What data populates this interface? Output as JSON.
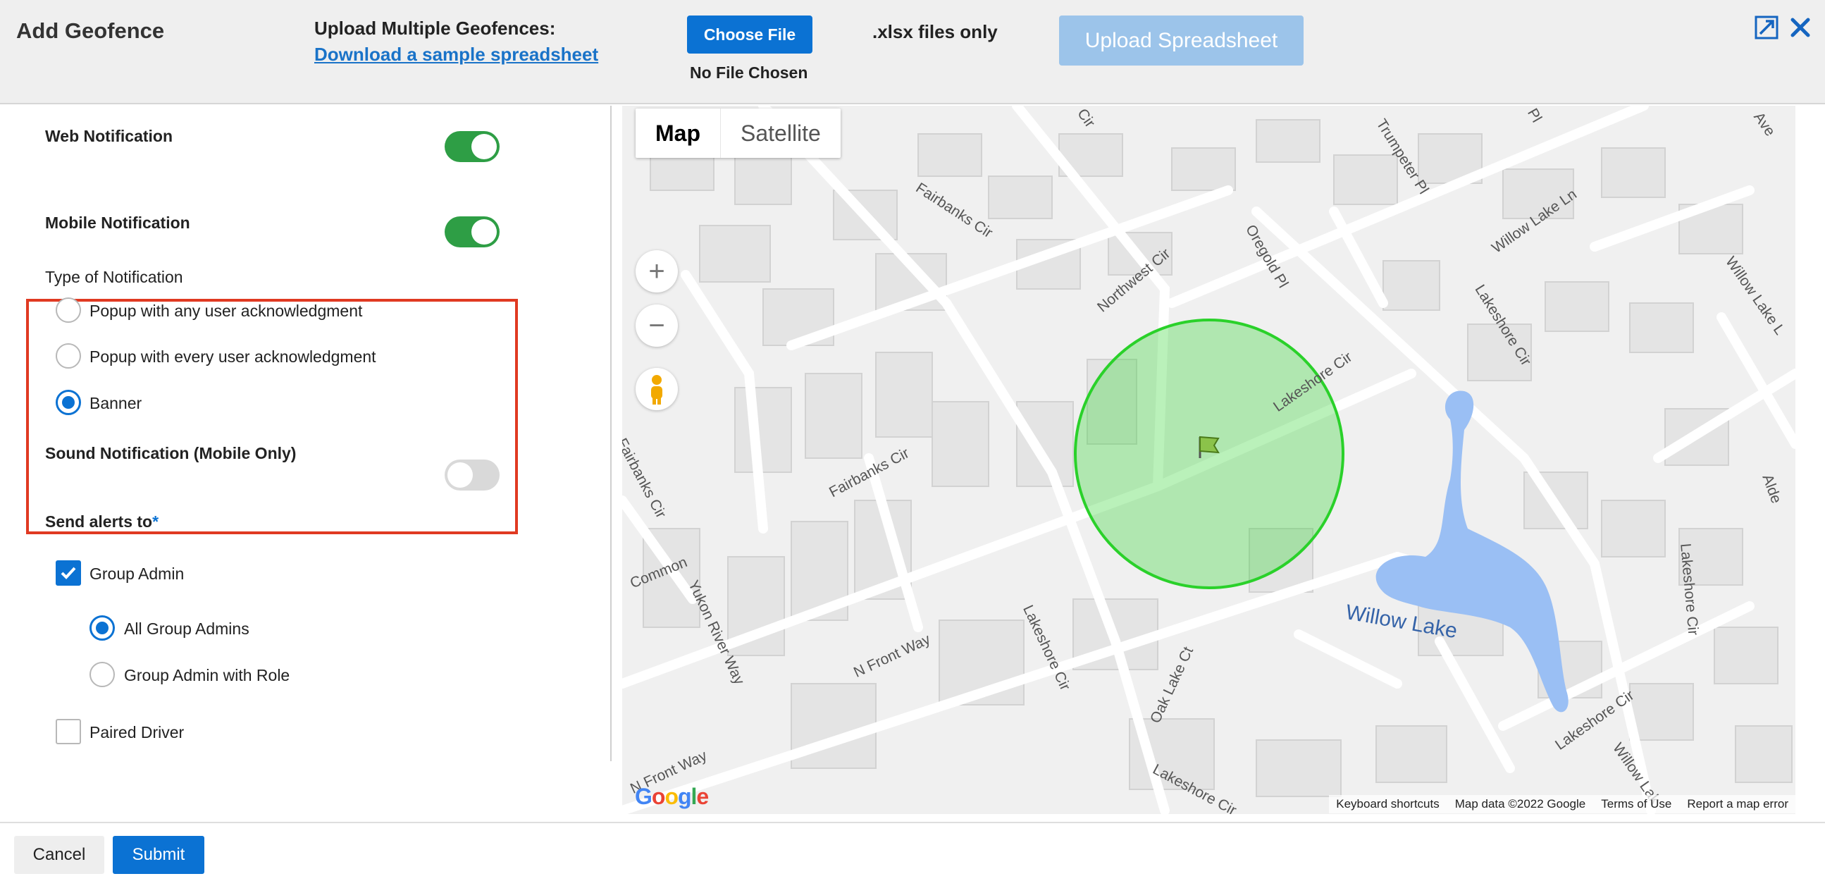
{
  "header": {
    "title": "Add Geofence",
    "upload_label": "Upload Multiple Geofences:",
    "sample_link": "Download a sample spreadsheet",
    "choose_file": "Choose File",
    "no_file": "No File Chosen",
    "xlsx_only": ".xlsx files only",
    "upload_button": "Upload Spreadsheet",
    "icons": [
      "expand-icon",
      "close-icon"
    ]
  },
  "form": {
    "web_notification": {
      "label": "Web Notification",
      "enabled": true
    },
    "mobile_notification": {
      "label": "Mobile Notification",
      "enabled": true
    },
    "type_label": "Type of Notification",
    "types": [
      {
        "label": "Popup with any user acknowledgment",
        "selected": false
      },
      {
        "label": "Popup with every user acknowledgment",
        "selected": false
      },
      {
        "label": "Banner",
        "selected": true
      }
    ],
    "sound_notification": {
      "label": "Sound Notification (Mobile Only)",
      "enabled": false
    },
    "send_alerts_label": "Send alerts to",
    "required_mark": "*",
    "group_admin": {
      "label": "Group Admin",
      "checked": true
    },
    "group_admin_options": [
      {
        "label": "All Group Admins",
        "selected": true
      },
      {
        "label": "Group Admin with Role",
        "selected": false
      }
    ],
    "paired_driver": {
      "label": "Paired Driver",
      "checked": false
    }
  },
  "map": {
    "map_tab": "Map",
    "satellite_tab": "Satellite",
    "zoom_in": "+",
    "zoom_out": "−",
    "google": "Google",
    "attribution": {
      "shortcuts": "Keyboard shortcuts",
      "data": "Map data ©2022 Google",
      "terms": "Terms of Use",
      "report": "Report a map error"
    },
    "labels": {
      "fairbanks_cir_1": "Fairbanks Cir",
      "fairbanks_cir_2": "Fairbanks Cir",
      "fairbanks_cir_3": "Fairbanks Cir",
      "northwest_cir": "Northwest Cir",
      "oregold_pl": "Oregold Pl",
      "trumpeter_pl": "Trumpeter Pl",
      "willow_lake_ln": "Willow Lake Ln",
      "willow_lake_l": "Willow Lake L",
      "lakeshore_cir_1": "Lakeshore Cir",
      "lakeshore_cir_2": "Lakeshore Cir",
      "lakeshore_cir_3": "Lakeshore Cir",
      "lakeshore_cir_4": "Lakeshore Cir",
      "lakeshore_cir_5": "Lakeshore Cir",
      "lakeshore_cir_6": "Lakeshore Cir",
      "yukon_river_way": "Yukon River Way",
      "n_front_way_1": "N Front Way",
      "n_front_way_2": "N Front Way",
      "oak_lake_ct": "Oak Lake Ct",
      "common": "Common",
      "willow_lake": "Willow Lake",
      "willow_lak": "Willow Lak",
      "alde": "Alde",
      "ave": "Ave",
      "cir": "Cir",
      "pl": "Pl"
    },
    "geofence_color": "#39d839"
  },
  "footer": {
    "cancel": "Cancel",
    "submit": "Submit"
  },
  "colors": {
    "primary": "#0b72d3",
    "toggle_on": "#2e9e45",
    "highlight": "#e03a22",
    "lake": "#9abff4"
  }
}
